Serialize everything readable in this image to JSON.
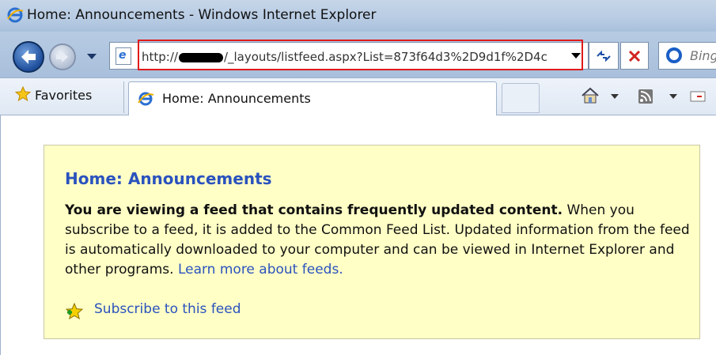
{
  "window": {
    "title": "Home: Announcements - Windows Internet Explorer",
    "icon": "ie-logo-icon"
  },
  "address_bar": {
    "url_prefix": "http://",
    "url_suffix": "/_layouts/listfeed.aspx?List=873f64d3%2D9d1f%2D4c",
    "redacted": true,
    "highlight_color": "#e01a1a"
  },
  "search": {
    "placeholder": "Bing"
  },
  "favorites_bar": {
    "favorites_label": "Favorites"
  },
  "tabs": [
    {
      "label": "Home: Announcements",
      "active": true
    }
  ],
  "feed": {
    "title": "Home: Announcements",
    "intro_bold": "You are viewing a feed that contains frequently updated content.",
    "intro_text": " When you subscribe to a feed, it is added to the Common Feed List. Updated information from the feed is automatically downloaded to your computer and can be viewed in Internet Explorer and other programs. ",
    "learn_more": "Learn more about feeds.",
    "subscribe_label": "Subscribe to this feed",
    "background_color": "#ffffc6",
    "link_color": "#2a52be"
  }
}
